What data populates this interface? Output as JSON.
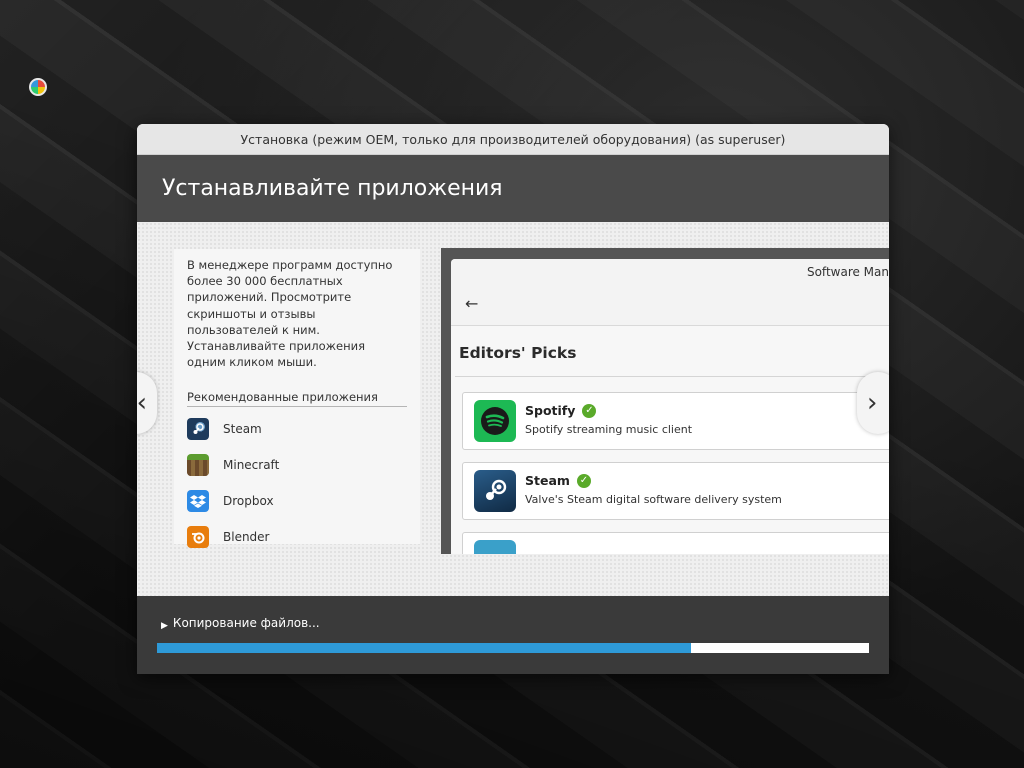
{
  "desktop": {
    "tray_icon": "color-wheel-icon"
  },
  "window": {
    "title": "Установка (режим OEM, только для производителей оборудования) (as superuser)",
    "header": "Устанавливайте приложения"
  },
  "slide": {
    "description": "В менеджере программ доступно более 30 000 бесплатных приложений. Просмотрите скриншоты и отзывы пользователей к ним. Устанавливайте приложения одним кликом мыши.",
    "recommended_title": "Рекомендованные приложения",
    "apps": [
      {
        "name": "Steam",
        "icon": "steam-icon"
      },
      {
        "name": "Minecraft",
        "icon": "minecraft-icon"
      },
      {
        "name": "Dropbox",
        "icon": "dropbox-icon"
      },
      {
        "name": "Blender",
        "icon": "blender-icon"
      }
    ],
    "prev_label": "‹",
    "next_label": "›"
  },
  "software_manager": {
    "title": "Software Man",
    "back_icon": "←",
    "section_heading": "Editors' Picks",
    "cards": [
      {
        "name": "Spotify",
        "description": "Spotify streaming music client",
        "icon": "spotify-icon",
        "verified": true
      },
      {
        "name": "Steam",
        "description": "Valve's Steam digital software delivery system",
        "icon": "steam-icon",
        "verified": true
      }
    ]
  },
  "footer": {
    "status": "Копирование файлов...",
    "progress": 0.75,
    "progress_color": "#2e9ad8"
  }
}
